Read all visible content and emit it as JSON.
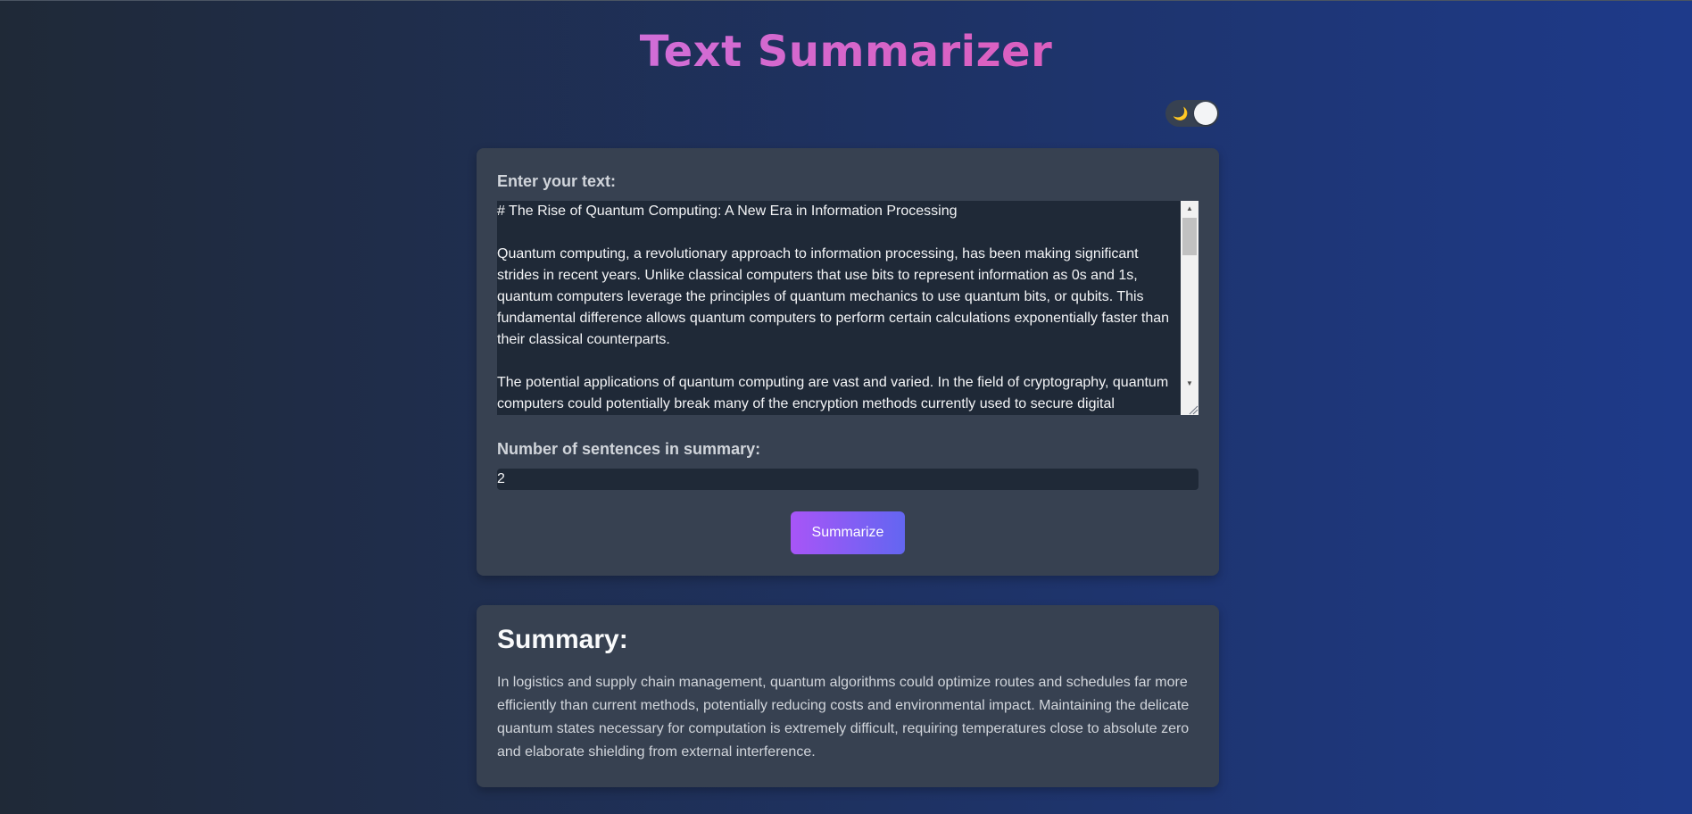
{
  "page": {
    "title": "Text Summarizer"
  },
  "theme_toggle": {
    "icon": "moon-icon",
    "glyph": "🌙"
  },
  "input_card": {
    "text_label": "Enter your text:",
    "text_value": "# The Rise of Quantum Computing: A New Era in Information Processing\n\nQuantum computing, a revolutionary approach to information processing, has been making significant strides in recent years. Unlike classical computers that use bits to represent information as 0s and 1s, quantum computers leverage the principles of quantum mechanics to use quantum bits, or qubits. This fundamental difference allows quantum computers to perform certain calculations exponentially faster than their classical counterparts.\n\nThe potential applications of quantum computing are vast and varied. In the field of cryptography, quantum computers could potentially break many of the encryption methods currently used to secure digital",
    "sentences_label": "Number of sentences in summary:",
    "sentences_value": "2",
    "button_label": "Summarize"
  },
  "summary_card": {
    "heading": "Summary:",
    "text": "In logistics and supply chain management, quantum algorithms could optimize routes and schedules far more efficiently than current methods, potentially reducing costs and environmental impact. Maintaining the delicate quantum states necessary for computation is extremely difficult, requiring temperatures close to absolute zero and elaborate shielding from external interference."
  },
  "colors": {
    "title_gradient_start": "#c084fc",
    "title_gradient_end": "#ec4899",
    "button_gradient_start": "#a855f7",
    "button_gradient_end": "#6366f1",
    "card_bg": "#374151",
    "input_bg": "#1f2937"
  }
}
